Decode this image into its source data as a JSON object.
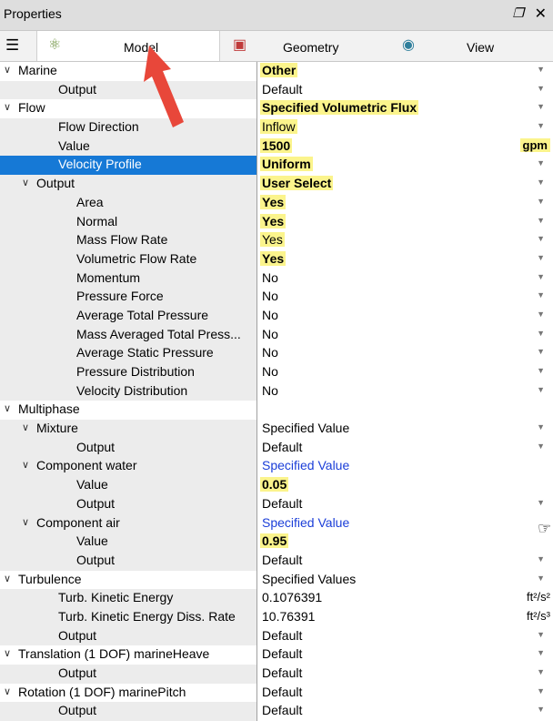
{
  "panel": {
    "title": "Properties"
  },
  "tabs": [
    {
      "icon": "physics-icon",
      "label": "Model",
      "active": true
    },
    {
      "icon": "geometry-cube-icon",
      "label": "Geometry",
      "active": false
    },
    {
      "icon": "view-eye-icon",
      "label": "View",
      "active": false
    }
  ],
  "rows": [
    {
      "name": "Marine",
      "indent": 0,
      "expander": true,
      "value": "Other",
      "bold": true,
      "highlight": true,
      "dropdown": true
    },
    {
      "name": "Output",
      "indent": 1,
      "value": "Default",
      "dropdown": true
    },
    {
      "name": "Flow",
      "indent": 0,
      "expander": true,
      "value": "Specified Volumetric Flux",
      "bold": true,
      "highlight": true,
      "dropdown": true
    },
    {
      "name": "Flow Direction",
      "indent": 1,
      "value": "Inflow",
      "highlight": true,
      "dropdown": true
    },
    {
      "name": "Value",
      "indent": 1,
      "value": "1500",
      "bold": true,
      "highlight": true,
      "unit": "gpm",
      "unit_highlight": true
    },
    {
      "name": "Velocity Profile",
      "indent": 1,
      "value": "Uniform",
      "bold": true,
      "highlight": true,
      "dropdown": true,
      "selected": true
    },
    {
      "name": "Output",
      "indent": 1,
      "expander": true,
      "value": "User Select",
      "bold": true,
      "highlight": true,
      "dropdown": true
    },
    {
      "name": "Area",
      "indent": 2,
      "value": "Yes",
      "bold": true,
      "highlight": true,
      "dropdown": true
    },
    {
      "name": "Normal",
      "indent": 2,
      "value": "Yes",
      "bold": true,
      "highlight": true,
      "dropdown": true
    },
    {
      "name": "Mass Flow Rate",
      "indent": 2,
      "value": "Yes",
      "highlight": true,
      "dropdown": true
    },
    {
      "name": "Volumetric Flow Rate",
      "indent": 2,
      "value": "Yes",
      "bold": true,
      "highlight": true,
      "dropdown": true
    },
    {
      "name": "Momentum",
      "indent": 2,
      "value": "No",
      "dropdown": true
    },
    {
      "name": "Pressure Force",
      "indent": 2,
      "value": "No",
      "dropdown": true
    },
    {
      "name": "Average Total Pressure",
      "indent": 2,
      "value": "No",
      "dropdown": true
    },
    {
      "name": "Mass Averaged Total Press...",
      "indent": 2,
      "value": "No",
      "dropdown": true
    },
    {
      "name": "Average Static Pressure",
      "indent": 2,
      "value": "No",
      "dropdown": true
    },
    {
      "name": "Pressure Distribution",
      "indent": 2,
      "value": "No",
      "dropdown": true
    },
    {
      "name": "Velocity Distribution",
      "indent": 2,
      "value": "No",
      "dropdown": true
    },
    {
      "name": "Multiphase",
      "indent": 0,
      "expander": true,
      "value": "",
      "group": true
    },
    {
      "name": "Mixture",
      "indent": 1,
      "expander": true,
      "value": "Specified Value",
      "dropdown": true
    },
    {
      "name": "Output",
      "indent": 2,
      "value": "Default",
      "dropdown": true
    },
    {
      "name": "Component water",
      "indent": 1,
      "expander": true,
      "value": "Specified Value",
      "blue": true
    },
    {
      "name": "Value",
      "indent": 2,
      "value": "0.05",
      "bold": true,
      "highlight": true
    },
    {
      "name": "Output",
      "indent": 2,
      "value": "Default",
      "dropdown": true
    },
    {
      "name": "Component air",
      "indent": 1,
      "expander": true,
      "value": "Specified Value",
      "blue": true
    },
    {
      "name": "Value",
      "indent": 2,
      "value": "0.95",
      "bold": true,
      "highlight": true,
      "dark": true
    },
    {
      "name": "Output",
      "indent": 2,
      "value": "Default",
      "dropdown": true
    },
    {
      "name": "Turbulence",
      "indent": 0,
      "expander": true,
      "value": "Specified Values",
      "dropdown": true
    },
    {
      "name": "Turb. Kinetic Energy",
      "indent": 1,
      "value": "0.1076391",
      "unit": "ft²/s²"
    },
    {
      "name": "Turb. Kinetic Energy Diss. Rate",
      "indent": 1,
      "value": "10.76391",
      "unit": "ft²/s³"
    },
    {
      "name": "Output",
      "indent": 1,
      "value": "Default",
      "dropdown": true
    },
    {
      "name": "Translation (1 DOF) marineHeave",
      "indent": 0,
      "expander": true,
      "value": "Default",
      "dropdown": true
    },
    {
      "name": "Output",
      "indent": 1,
      "value": "Default",
      "dropdown": true
    },
    {
      "name": "Rotation (1 DOF) marinePitch",
      "indent": 0,
      "expander": true,
      "value": "Default",
      "dropdown": true
    },
    {
      "name": "Output",
      "indent": 1,
      "value": "Default",
      "dropdown": true
    }
  ],
  "icons": {
    "expand": "chevron-down-icon",
    "dropdown": "dropdown-arrow-icon"
  },
  "colors": {
    "highlight": "#fbf48c",
    "selection": "#1679d6",
    "link_value": "#1b3ed8",
    "annotation_arrow": "#e8473a"
  }
}
